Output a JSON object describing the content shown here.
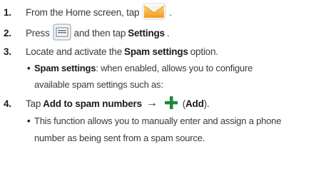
{
  "steps": [
    {
      "number": "1.",
      "text_before": "From the Home screen, tap",
      "icon": "email-app-icon",
      "text_after": "."
    },
    {
      "number": "2.",
      "text_before": "Press",
      "icon": "menu-key-icon",
      "text_middle": "and then tap",
      "bold": "Settings",
      "text_after": "."
    },
    {
      "number": "3.",
      "text_before": "Locate and activate the",
      "bold": "Spam settings",
      "text_after": "option.",
      "bullet": {
        "bold": "Spam settings",
        "text_line1": ": when enabled, allows you to configure",
        "text_line2": "available spam settings such as:"
      }
    },
    {
      "number": "4.",
      "text_before": "Tap",
      "bold": "Add to spam numbers",
      "arrow": "→",
      "icon": "add-icon",
      "paren_open": "(",
      "bold_paren": "Add",
      "paren_close": ").",
      "bullet": {
        "text_line1": "This function allows you to manually enter and assign a phone",
        "text_line2": "number as being sent from a spam source."
      }
    }
  ],
  "colors": {
    "envelope_orange": "#f5a623",
    "add_green": "#1b8a3a",
    "text": "#3a3a3a"
  }
}
